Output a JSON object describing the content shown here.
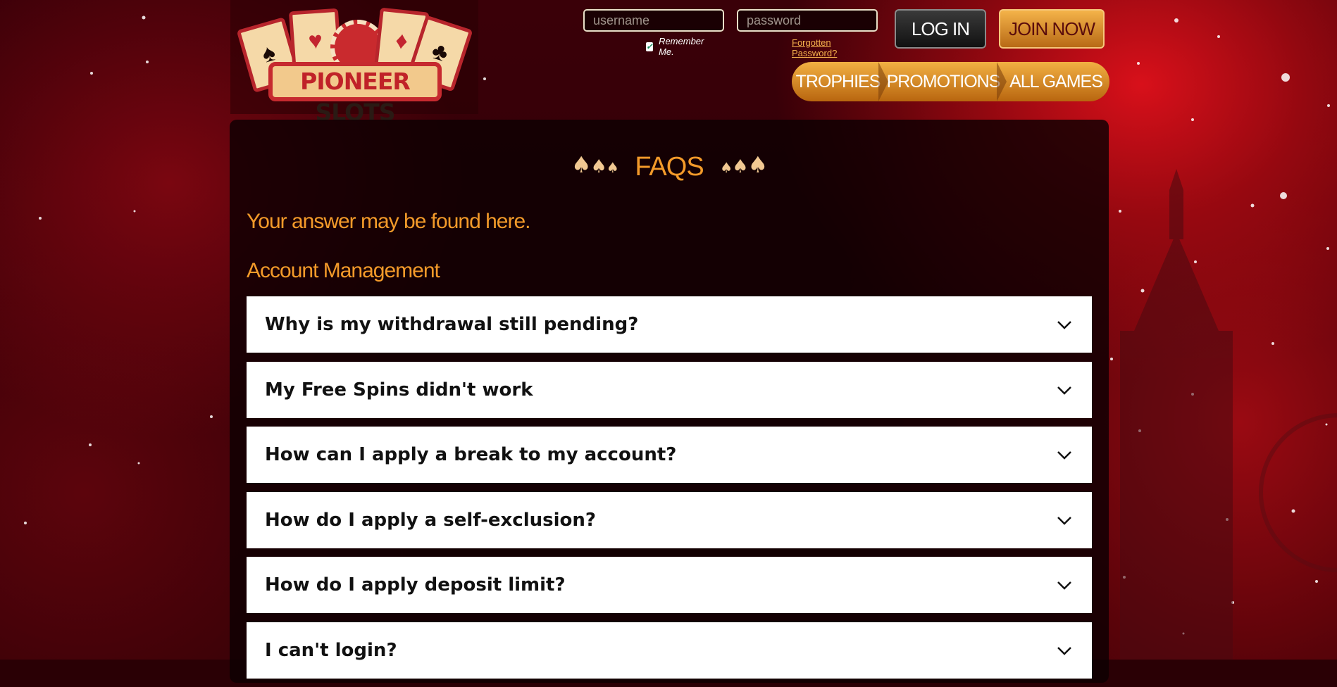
{
  "brand": {
    "name_part1": "PIONEER",
    "name_part2": "SLOTS"
  },
  "login": {
    "username_placeholder": "username",
    "password_placeholder": "password",
    "remember_label": "Remember Me.",
    "remember_checked": true,
    "forgot_label": "Forgotten Password?",
    "login_button": "LOG IN",
    "join_button": "JOIN NOW"
  },
  "nav": {
    "items": [
      {
        "label": "TROPHIES"
      },
      {
        "label": "PROMOTIONS"
      },
      {
        "label": "ALL GAMES"
      }
    ]
  },
  "main": {
    "title": "FAQS",
    "subtitle": "Your answer may be found here.",
    "section_title": "Account Management",
    "questions": [
      {
        "text": "Why is my withdrawal still pending?"
      },
      {
        "text": "My Free Spins didn't work"
      },
      {
        "text": "How can I apply a break to my account?"
      },
      {
        "text": "How do I apply a self-exclusion?"
      },
      {
        "text": "How do I apply deposit limit?"
      },
      {
        "text": "I can't login?"
      }
    ]
  },
  "colors": {
    "accent_orange": "#f39a2a",
    "brand_red": "#c62a2f",
    "background": "#2a0005"
  }
}
